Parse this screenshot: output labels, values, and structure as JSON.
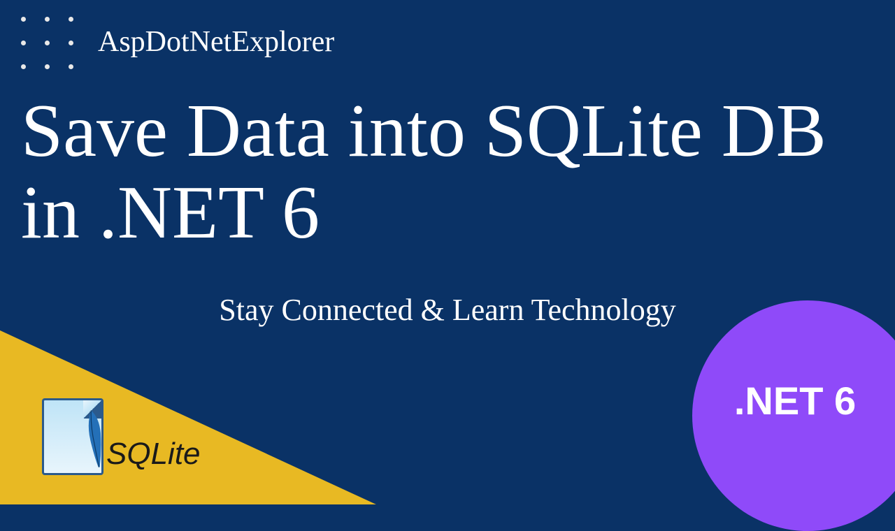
{
  "channel_name": "AspDotNetExplorer",
  "title": "Save Data into SQLite DB in .NET 6",
  "subtitle": "Stay Connected & Learn Technology",
  "sqlite_label": "SQLite",
  "badge_label": ".NET 6",
  "colors": {
    "background": "#0a3266",
    "accent_triangle": "#e8b923",
    "badge": "#8f4af9",
    "text": "#ffffff"
  }
}
